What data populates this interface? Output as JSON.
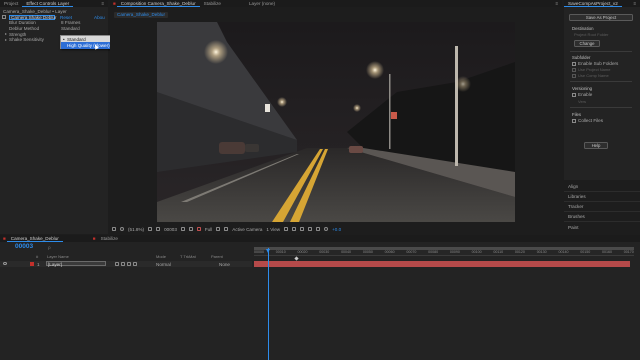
{
  "left": {
    "tabs": {
      "project": "Project",
      "effect_controls": "Effect Controls Layer",
      "menu": "≡"
    },
    "header": "Camera_Shake_Deblur • Layer",
    "effect": {
      "name": "Camera Shake Deblur",
      "reset": "Reset",
      "about": "Abou"
    },
    "params": [
      {
        "label": "Blur Duration",
        "value": "8 Frames"
      },
      {
        "label": "Deblur Method",
        "value": "Standard"
      },
      {
        "label": "Strength",
        "value": ""
      },
      {
        "label": "Shake Sensitivity",
        "value": ""
      }
    ],
    "dropdown": {
      "options": [
        "Standard",
        "High Quality (slower)"
      ]
    }
  },
  "comp": {
    "tabs": {
      "comp": "Composition Camera_Shake_Deblur",
      "stabilize": "Stabilize",
      "layer": "Layer (none)"
    },
    "subtab": "Camera_Shake_Deblur",
    "footer": {
      "zoom": "(51.8%)",
      "timecode": "00003",
      "resolution": "Full",
      "camera": "Active Camera",
      "view": "1 View",
      "exposure": "+0.0"
    }
  },
  "right": {
    "title": "SaveCompAsProject_v2",
    "save_button": "Save As Project",
    "destination_label": "Destination",
    "destination_path": "Project Root Folder",
    "change_button": "Change",
    "subfolder_label": "Subfolder",
    "subfolder_options": [
      "Enable Sub Folders",
      "Use Project Name",
      "Use Comp Name"
    ],
    "versioning_label": "Versioning",
    "versioning_enable": "Enable",
    "versioning_field": "Vers",
    "files_label": "Files",
    "collect_files": "Collect Files",
    "help_button": "Help",
    "panels": [
      "Align",
      "Libraries",
      "Tracker",
      "Brushes",
      "Paint"
    ]
  },
  "timeline": {
    "tabs": {
      "comp": "Camera_Shake_Deblur",
      "stabilize": "Stabilize"
    },
    "timecode": "00003",
    "search_placeholder": "ρ",
    "columns": {
      "num": "#",
      "layer_name": "Layer Name",
      "mode": "Mode",
      "trkmat": "T TrkMat",
      "parent": "Parent"
    },
    "layer": {
      "num": "1",
      "name": "[Layer]",
      "mode": "Normal",
      "parent": "None"
    },
    "ruler": [
      "00000",
      "00010",
      "00020",
      "00030",
      "00040",
      "00050",
      "00060",
      "00070",
      "00080",
      "00090",
      "00100",
      "00110",
      "00120",
      "00130",
      "00140",
      "00150",
      "00160",
      "00170"
    ]
  }
}
